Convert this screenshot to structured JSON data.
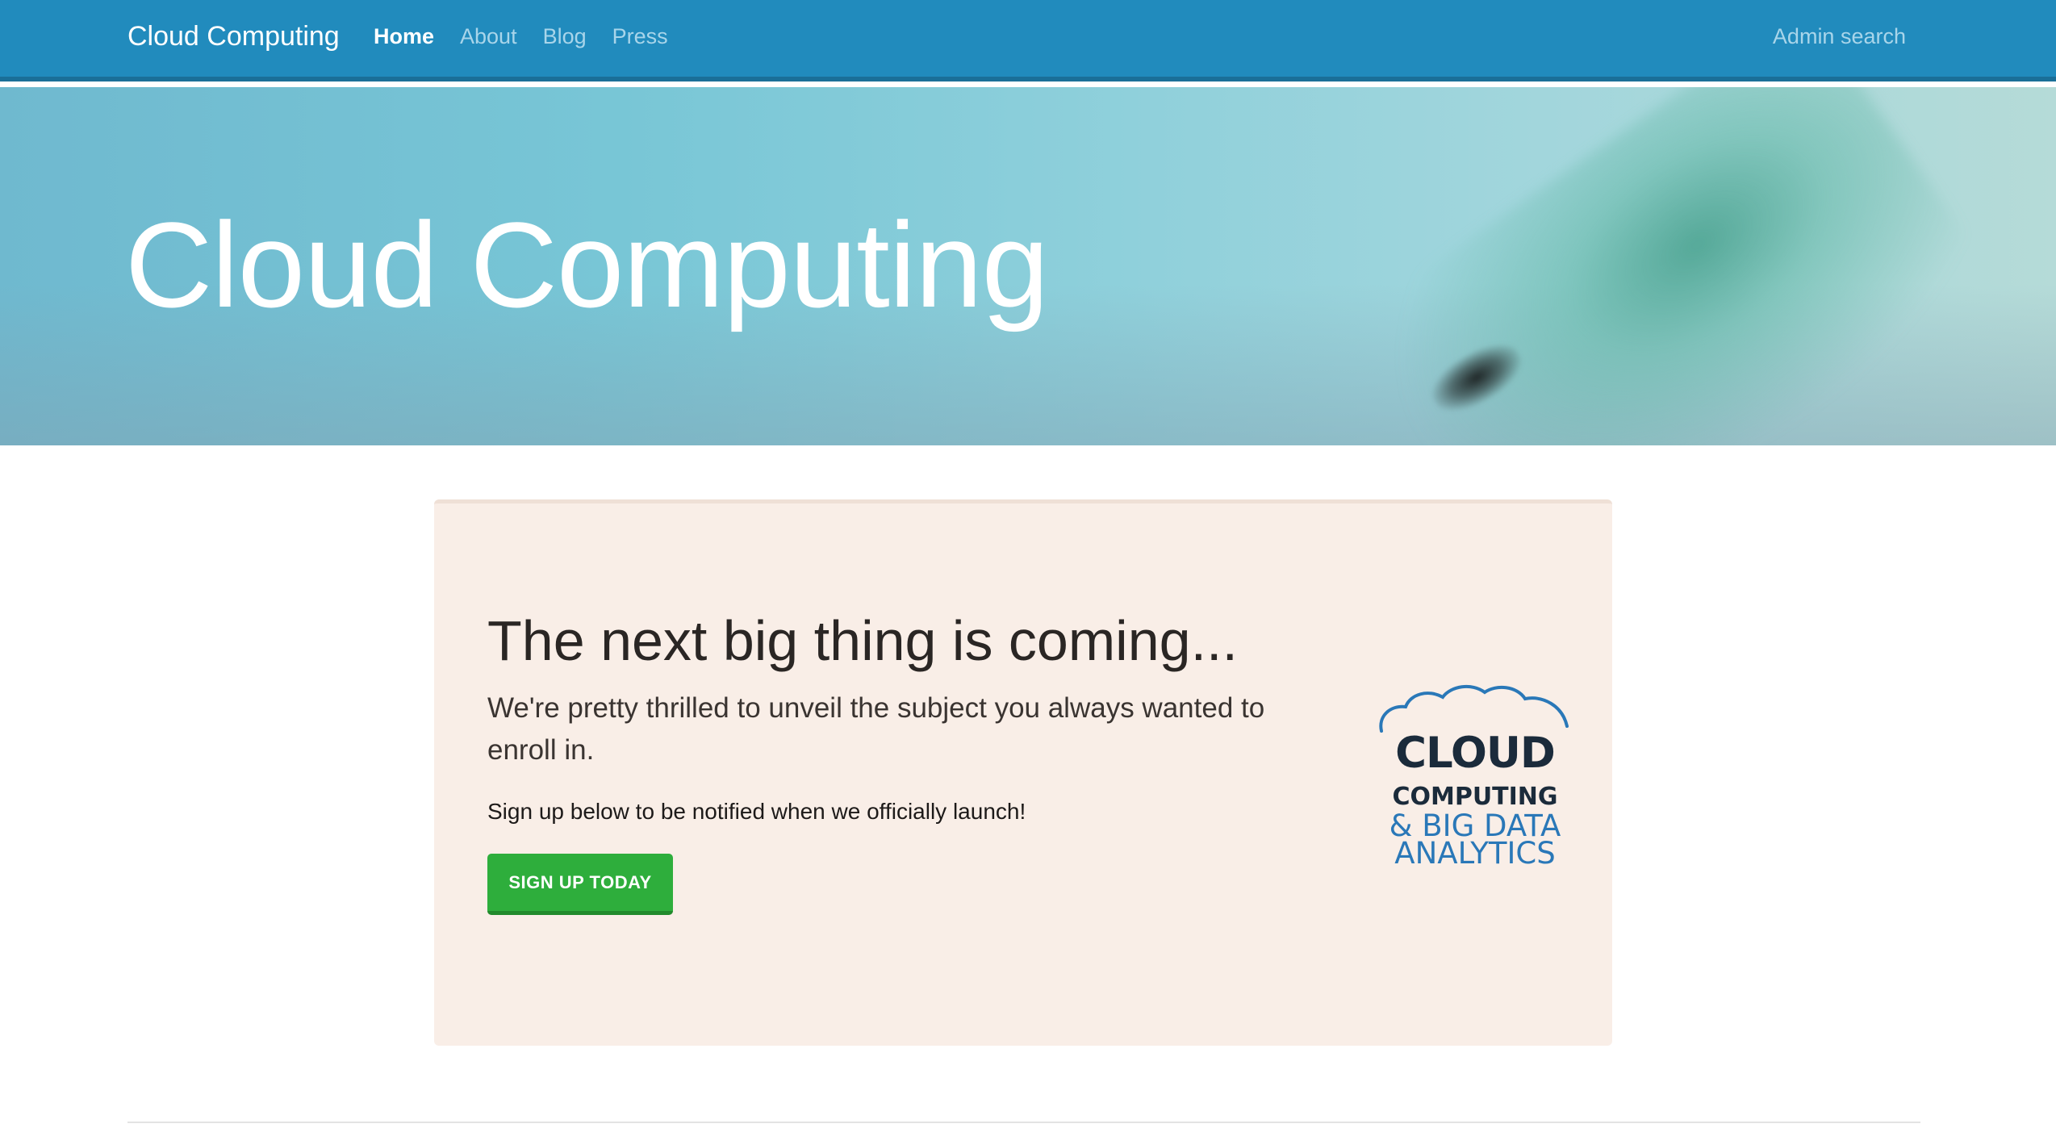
{
  "navbar": {
    "brand": "Cloud Computing",
    "links": [
      {
        "label": "Home",
        "active": true
      },
      {
        "label": "About",
        "active": false
      },
      {
        "label": "Blog",
        "active": false
      },
      {
        "label": "Press",
        "active": false
      }
    ],
    "right_link": "Admin search"
  },
  "hero": {
    "title": "Cloud Computing"
  },
  "promo": {
    "heading": "The next big thing is coming...",
    "lead": "We're pretty thrilled to unveil the subject you always wanted to enroll in.",
    "note": "Sign up below to be notified when we officially launch!",
    "button_label": "SIGN UP TODAY",
    "logo": {
      "line1": "CLOUD",
      "line2": "COMPUTING",
      "line3": "& BIG DATA",
      "line4": "ANALYTICS",
      "icon": "cloud-icon"
    }
  },
  "colors": {
    "navbar": "#218bbd",
    "navbar_border": "#1a6f98",
    "card_bg": "#f9eee7",
    "button": "#2eae3c",
    "logo_dark": "#1b2b3b",
    "logo_blue": "#2a78b8"
  }
}
